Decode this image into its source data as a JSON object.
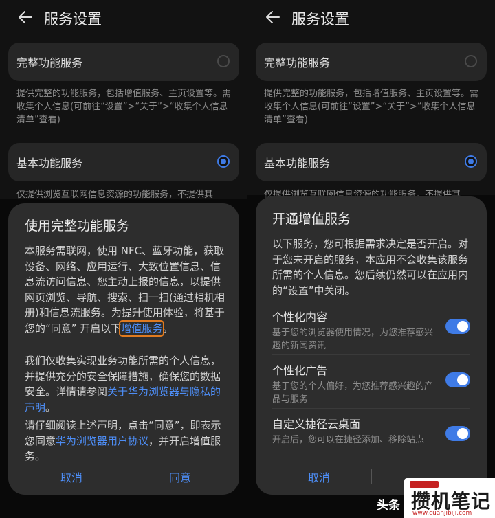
{
  "left": {
    "title": "服务设置",
    "full_option": "完整功能服务",
    "full_desc": "提供完整的功能服务，包括增值服务、主页设置等。需收集个人信息(可前往“设置”>“关于”>“收集个人信息清单”查看)",
    "basic_option": "基本功能服务",
    "basic_desc": "仅提供浏览互联网信息资源的功能服务，不提供其",
    "dialog": {
      "title": "使用完整功能服务",
      "p1": "本服务需联网，使用 NFC、蓝牙功能，获取设备、网络、应用运行、大致位置信息、信息流访问信息、您主动上报的信息，以提供网页浏览、导航、搜索、扫一扫(通过相机相册)和信息流服务。为提升使用体验，将基于您的“同意” 开启以下",
      "p1_link": "增值服务",
      "p1_end": "。",
      "p2": "我们仅收集实现业务功能所需的个人信息，并提供充分的安全保障措施，确保您的数据安全。详情请参阅",
      "p2_link": "关于华为浏览器与隐私的声明",
      "p2_end": "。",
      "p3": "请仔细阅读上述声明，点击“同意”，即表示您同意",
      "p3_link": "华为浏览器用户协议",
      "p3_end": "，并开启增值服务。",
      "cancel": "取消",
      "agree": "同意"
    }
  },
  "right": {
    "title": "服务设置",
    "full_option": "完整功能服务",
    "full_desc": "提供完整的功能服务，包括增值服务、主页设置等。需收集个人信息(可前往“设置”>“关于”>“收集个人信息清单”查看)",
    "basic_option": "基本功能服务",
    "basic_desc": "仅提供浏览互联网信息资源的功能服务，不提供其",
    "dialog": {
      "title": "开通增值服务",
      "intro": "以下服务，您可根据需求决定是否开启。对于您未开启的服务，本应用不会收集该服务所需的个人信息。您后续仍然可以在应用内的“设置”中关闭。",
      "options": [
        {
          "title": "个性化内容",
          "desc": "基于您的浏览器使用情况，为您推荐感兴趣的新闻资讯",
          "on": true
        },
        {
          "title": "个性化广告",
          "desc": "基于您的个人偏好，为您推荐感兴趣的产品与服务",
          "on": true
        },
        {
          "title": "自定义捷径云桌面",
          "desc": "开启后，您可以在捷径添加、移除站点",
          "on": true
        }
      ],
      "cancel": "取消"
    }
  },
  "watermark": {
    "prefix": "头条",
    "brand": "攒机笔记",
    "url": "www.cuanjibiji.com"
  },
  "colors": {
    "accent": "#3f7be6",
    "link": "#4d8df5",
    "highlight": "#e07a1f"
  }
}
